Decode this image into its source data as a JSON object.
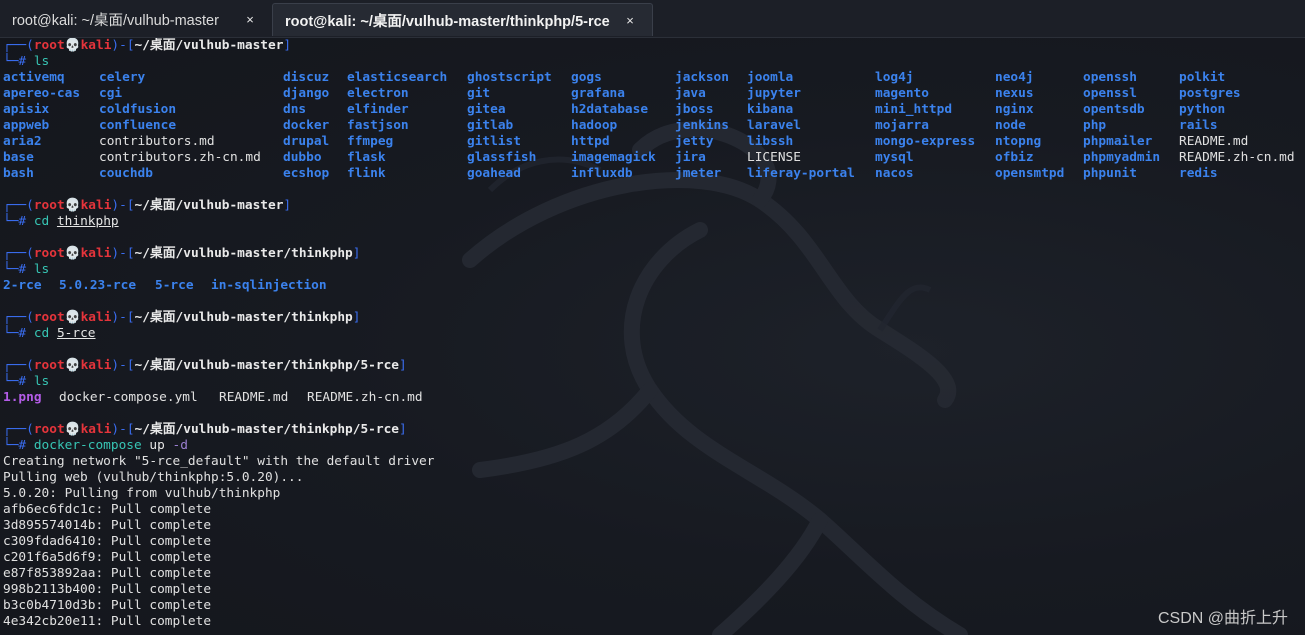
{
  "tabs": [
    {
      "label": "root@kali: ~/桌面/vulhub-master",
      "close": "×",
      "active": false
    },
    {
      "label": "root@kali: ~/桌面/vulhub-master/thinkphp/5-rce",
      "close": "×",
      "active": true
    }
  ],
  "prompt": {
    "user": "root",
    "skull": "💀",
    "host": "kali"
  },
  "blocks": [
    {
      "path": "~/桌面/vulhub-master",
      "command": [
        {
          "text": "ls",
          "style": "cmd-main"
        }
      ],
      "listing_columns": [
        [
          {
            "text": "activemq",
            "type": "dir"
          },
          {
            "text": "apereo-cas",
            "type": "dir"
          },
          {
            "text": "apisix",
            "type": "dir"
          },
          {
            "text": "appweb",
            "type": "dir"
          },
          {
            "text": "aria2",
            "type": "dir"
          },
          {
            "text": "base",
            "type": "dir"
          },
          {
            "text": "bash",
            "type": "dir"
          }
        ],
        [
          {
            "text": "celery",
            "type": "dir"
          },
          {
            "text": "cgi",
            "type": "dir"
          },
          {
            "text": "coldfusion",
            "type": "dir"
          },
          {
            "text": "confluence",
            "type": "dir"
          },
          {
            "text": "contributors.md",
            "type": "file"
          },
          {
            "text": "contributors.zh-cn.md",
            "type": "file"
          },
          {
            "text": "couchdb",
            "type": "dir"
          }
        ],
        [
          {
            "text": "discuz",
            "type": "dir"
          },
          {
            "text": "django",
            "type": "dir"
          },
          {
            "text": "dns",
            "type": "dir"
          },
          {
            "text": "docker",
            "type": "dir"
          },
          {
            "text": "drupal",
            "type": "dir"
          },
          {
            "text": "dubbo",
            "type": "dir"
          },
          {
            "text": "ecshop",
            "type": "dir"
          }
        ],
        [
          {
            "text": "elasticsearch",
            "type": "dir"
          },
          {
            "text": "electron",
            "type": "dir"
          },
          {
            "text": "elfinder",
            "type": "dir"
          },
          {
            "text": "fastjson",
            "type": "dir"
          },
          {
            "text": "ffmpeg",
            "type": "dir"
          },
          {
            "text": "flask",
            "type": "dir"
          },
          {
            "text": "flink",
            "type": "dir"
          }
        ],
        [
          {
            "text": "ghostscript",
            "type": "dir"
          },
          {
            "text": "git",
            "type": "dir"
          },
          {
            "text": "gitea",
            "type": "dir"
          },
          {
            "text": "gitlab",
            "type": "dir"
          },
          {
            "text": "gitlist",
            "type": "dir"
          },
          {
            "text": "glassfish",
            "type": "dir"
          },
          {
            "text": "goahead",
            "type": "dir"
          }
        ],
        [
          {
            "text": "gogs",
            "type": "dir"
          },
          {
            "text": "grafana",
            "type": "dir"
          },
          {
            "text": "h2database",
            "type": "dir"
          },
          {
            "text": "hadoop",
            "type": "dir"
          },
          {
            "text": "httpd",
            "type": "dir"
          },
          {
            "text": "imagemagick",
            "type": "dir"
          },
          {
            "text": "influxdb",
            "type": "dir"
          }
        ],
        [
          {
            "text": "jackson",
            "type": "dir"
          },
          {
            "text": "java",
            "type": "dir"
          },
          {
            "text": "jboss",
            "type": "dir"
          },
          {
            "text": "jenkins",
            "type": "dir"
          },
          {
            "text": "jetty",
            "type": "dir"
          },
          {
            "text": "jira",
            "type": "dir"
          },
          {
            "text": "jmeter",
            "type": "dir"
          }
        ],
        [
          {
            "text": "joomla",
            "type": "dir"
          },
          {
            "text": "jupyter",
            "type": "dir"
          },
          {
            "text": "kibana",
            "type": "dir"
          },
          {
            "text": "laravel",
            "type": "dir"
          },
          {
            "text": "libssh",
            "type": "dir"
          },
          {
            "text": "LICENSE",
            "type": "file"
          },
          {
            "text": "liferay-portal",
            "type": "dir"
          }
        ],
        [
          {
            "text": "log4j",
            "type": "dir"
          },
          {
            "text": "magento",
            "type": "dir"
          },
          {
            "text": "mini_httpd",
            "type": "dir"
          },
          {
            "text": "mojarra",
            "type": "dir"
          },
          {
            "text": "mongo-express",
            "type": "dir"
          },
          {
            "text": "mysql",
            "type": "dir"
          },
          {
            "text": "nacos",
            "type": "dir"
          }
        ],
        [
          {
            "text": "neo4j",
            "type": "dir"
          },
          {
            "text": "nexus",
            "type": "dir"
          },
          {
            "text": "nginx",
            "type": "dir"
          },
          {
            "text": "node",
            "type": "dir"
          },
          {
            "text": "ntopng",
            "type": "dir"
          },
          {
            "text": "ofbiz",
            "type": "dir"
          },
          {
            "text": "opensmtpd",
            "type": "dir"
          }
        ],
        [
          {
            "text": "openssh",
            "type": "dir"
          },
          {
            "text": "openssl",
            "type": "dir"
          },
          {
            "text": "opentsdb",
            "type": "dir"
          },
          {
            "text": "php",
            "type": "dir"
          },
          {
            "text": "phpmailer",
            "type": "dir"
          },
          {
            "text": "phpmyadmin",
            "type": "dir"
          },
          {
            "text": "phpunit",
            "type": "dir"
          }
        ],
        [
          {
            "text": "polkit",
            "type": "dir"
          },
          {
            "text": "postgres",
            "type": "dir"
          },
          {
            "text": "python",
            "type": "dir"
          },
          {
            "text": "rails",
            "type": "dir"
          },
          {
            "text": "README.md",
            "type": "file"
          },
          {
            "text": "README.zh-cn.md",
            "type": "file"
          },
          {
            "text": "redis",
            "type": "dir"
          }
        ]
      ],
      "output": []
    },
    {
      "path": "~/桌面/vulhub-master",
      "command": [
        {
          "text": "cd",
          "style": "cmd-main"
        },
        {
          "text": " ",
          "style": "cmd-plain"
        },
        {
          "text": "thinkphp",
          "style": "cmd-arg-u"
        }
      ],
      "output": []
    },
    {
      "path": "~/桌面/vulhub-master/thinkphp",
      "command": [
        {
          "text": "ls",
          "style": "cmd-main"
        }
      ],
      "inline_listing": [
        {
          "text": "2-rce",
          "type": "dir"
        },
        {
          "text": "5.0.23-rce",
          "type": "dir"
        },
        {
          "text": "5-rce",
          "type": "dir"
        },
        {
          "text": "in-sqlinjection",
          "type": "dir"
        }
      ],
      "output": []
    },
    {
      "path": "~/桌面/vulhub-master/thinkphp",
      "command": [
        {
          "text": "cd",
          "style": "cmd-main"
        },
        {
          "text": " ",
          "style": "cmd-plain"
        },
        {
          "text": "5-rce",
          "style": "cmd-arg-u"
        }
      ],
      "output": []
    },
    {
      "path": "~/桌面/vulhub-master/thinkphp/5-rce",
      "command": [
        {
          "text": "ls",
          "style": "cmd-main"
        }
      ],
      "inline_listing": [
        {
          "text": "1.png",
          "type": "img"
        },
        {
          "text": "docker-compose.yml",
          "type": "file"
        },
        {
          "text": "README.md",
          "type": "file"
        },
        {
          "text": "README.zh-cn.md",
          "type": "file"
        }
      ],
      "output": []
    },
    {
      "path": "~/桌面/vulhub-master/thinkphp/5-rce",
      "command": [
        {
          "text": "docker-compose",
          "style": "cmd-main"
        },
        {
          "text": " up ",
          "style": "cmd-plain"
        },
        {
          "text": "-d",
          "style": "cmd-flag"
        }
      ],
      "output": [
        "Creating network \"5-rce_default\" with the default driver",
        "Pulling web (vulhub/thinkphp:5.0.20)...",
        "5.0.20: Pulling from vulhub/thinkphp",
        "afb6ec6fdc1c: Pull complete",
        "3d895574014b: Pull complete",
        "c309fdad6410: Pull complete",
        "c201f6a5d6f9: Pull complete",
        "e87f853892aa: Pull complete",
        "998b2113b400: Pull complete",
        "b3c0b4710d3b: Pull complete",
        "4e342cb20e11: Pull complete"
      ]
    }
  ],
  "watermark": "CSDN @曲折上升"
}
